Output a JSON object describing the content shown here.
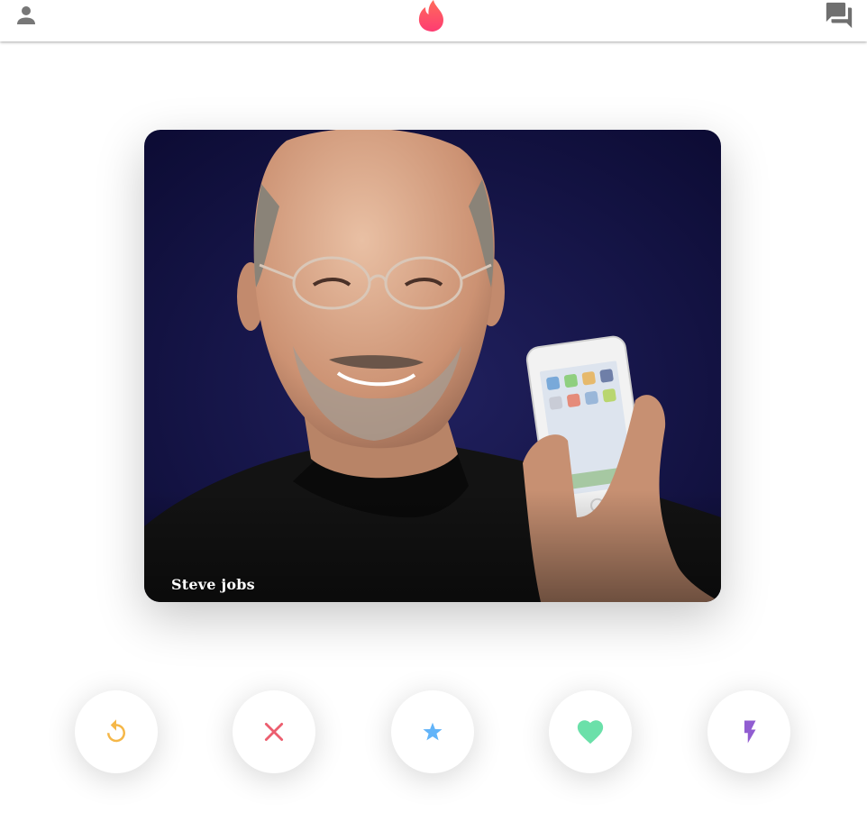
{
  "header": {
    "profile_icon": "person-icon",
    "logo_icon": "flame-icon",
    "chat_icon": "forum-icon"
  },
  "card": {
    "name": "Steve jobs"
  },
  "actions": [
    {
      "id": "replay",
      "icon": "replay-icon",
      "color": "#f5b748"
    },
    {
      "id": "close",
      "icon": "close-icon",
      "color": "#ec5e6f"
    },
    {
      "id": "star",
      "icon": "star-icon",
      "color": "#62b4f9"
    },
    {
      "id": "heart",
      "icon": "heart-icon",
      "color": "#6be0a9"
    },
    {
      "id": "flash",
      "icon": "flash-icon",
      "color": "#915dd1"
    }
  ],
  "colors": {
    "brand": "#fd5068",
    "header_icon": "#777777"
  }
}
